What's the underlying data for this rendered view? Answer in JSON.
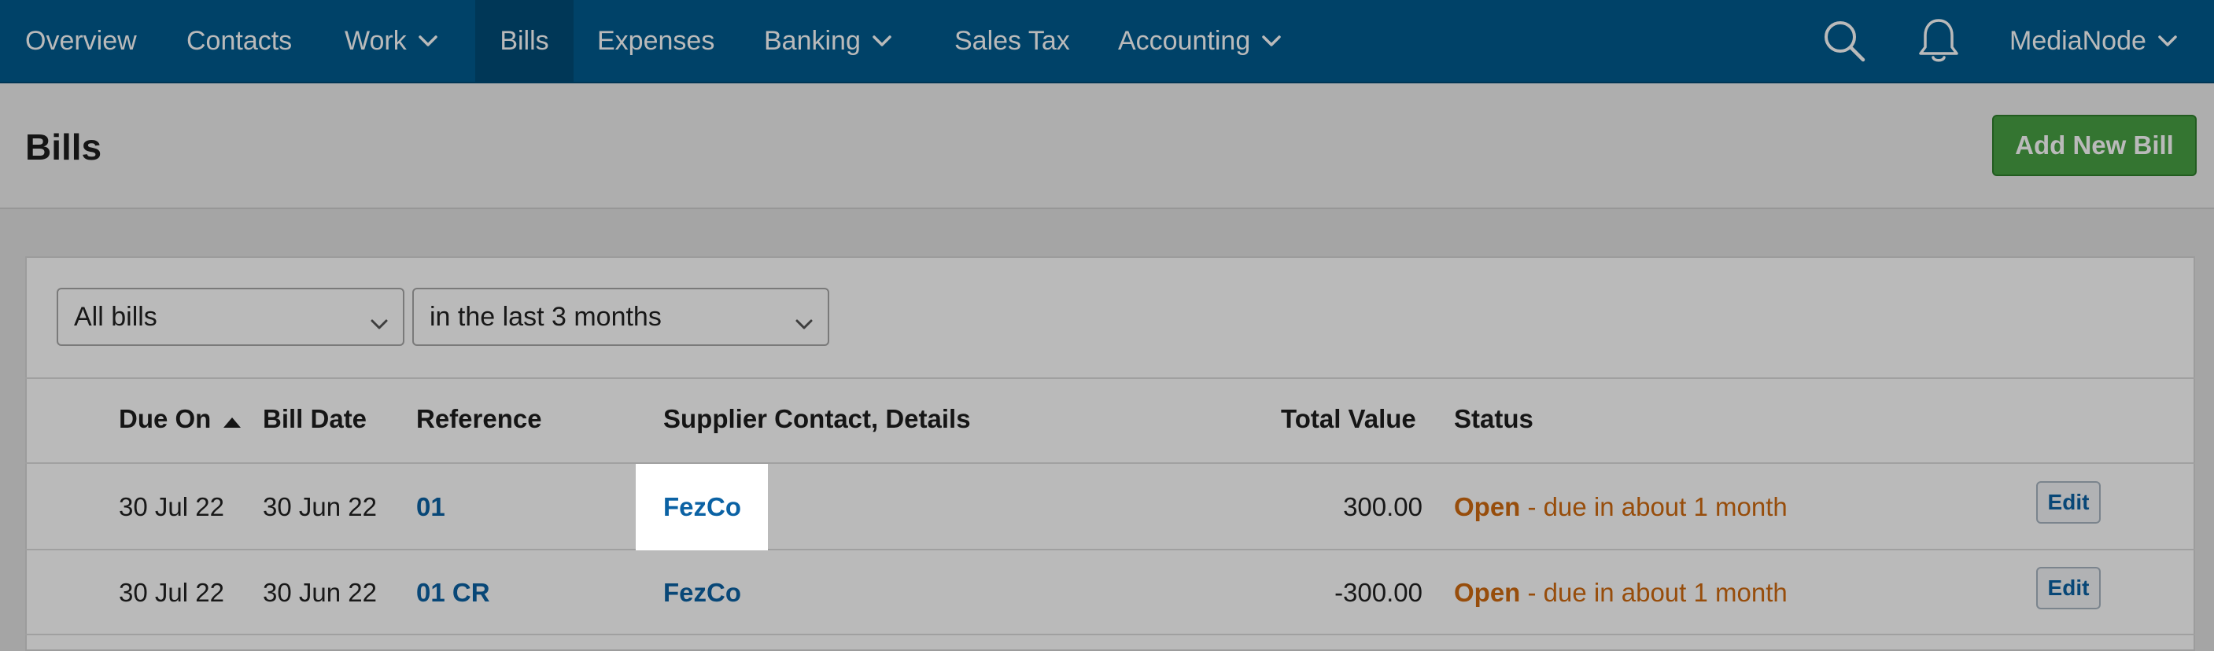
{
  "nav": {
    "items": [
      {
        "label": "Overview"
      },
      {
        "label": "Contacts"
      },
      {
        "label": "Work"
      },
      {
        "label": "Bills"
      },
      {
        "label": "Expenses"
      },
      {
        "label": "Banking"
      },
      {
        "label": "Sales Tax"
      },
      {
        "label": "Accounting"
      }
    ],
    "active": "Bills",
    "account_label": "MediaNode",
    "icons": [
      "search-icon",
      "bell-icon",
      "chevron-down-icon"
    ]
  },
  "page": {
    "title": "Bills",
    "add_button_label": "Add New Bill"
  },
  "filters": {
    "type_value": "All bills",
    "period_value": "in the last 3 months"
  },
  "table": {
    "headers": {
      "due_on": "Due On",
      "bill_date": "Bill Date",
      "reference": "Reference",
      "supplier": "Supplier Contact, Details",
      "total": "Total Value",
      "status": "Status"
    },
    "sort_indicator": "ascending",
    "rows": [
      {
        "due_on": "30 Jul 22",
        "bill_date": "30 Jun 22",
        "reference": "01",
        "supplier": "FezCo",
        "total": "300.00",
        "status_word": "Open",
        "status_detail": " - due in about 1 month",
        "action": "Edit"
      },
      {
        "due_on": "30 Jul 22",
        "bill_date": "30 Jun 22",
        "reference": "01 CR",
        "supplier": "FezCo",
        "total": "-300.00",
        "status_word": "Open",
        "status_detail": " - due in about 1 month",
        "action": "Edit"
      }
    ]
  },
  "colors": {
    "nav_bg": "#005b8f",
    "link": "#0b62a4",
    "status_open": "#d06a10",
    "add_button": "#48a144"
  }
}
